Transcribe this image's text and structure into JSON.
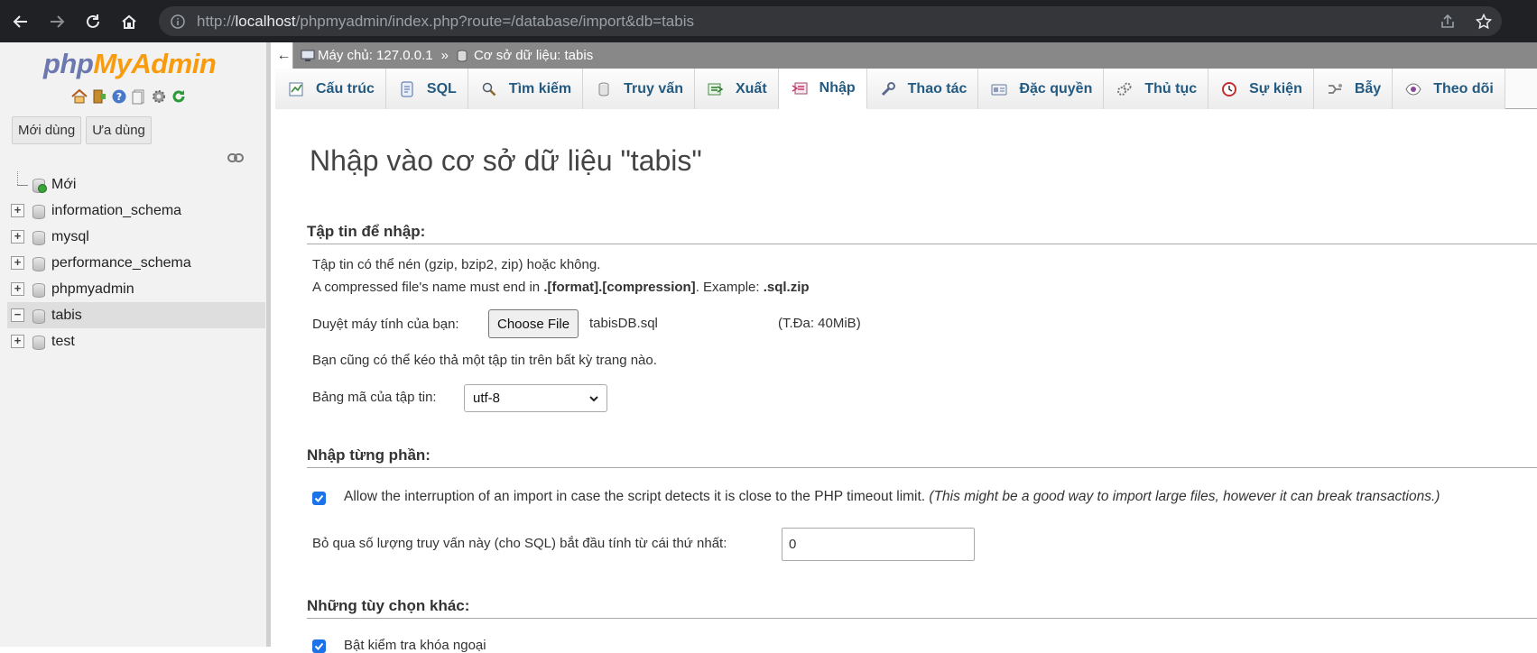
{
  "browser": {
    "url_prefix": "http://",
    "url_host": "localhost",
    "url_path": "/phpmyadmin/index.php?route=/database/import&db=tabis"
  },
  "sidebar": {
    "logo_php": "php",
    "logo_myadmin": "MyAdmin",
    "recent_label": "Mới dùng",
    "favorites_label": "Ưa dùng",
    "tree": [
      {
        "label": "Mới",
        "type": "new"
      },
      {
        "label": "information_schema",
        "type": "db"
      },
      {
        "label": "mysql",
        "type": "db"
      },
      {
        "label": "performance_schema",
        "type": "db"
      },
      {
        "label": "phpmyadmin",
        "type": "db"
      },
      {
        "label": "tabis",
        "type": "db",
        "selected": true
      },
      {
        "label": "test",
        "type": "db"
      }
    ]
  },
  "breadcrumb": {
    "collapse_glyph": "←",
    "server": "Máy chủ: 127.0.0.1",
    "separator": "»",
    "database": "Cơ sở dữ liệu: tabis"
  },
  "tabs": [
    {
      "label": "Cấu trúc",
      "icon": "structure-icon"
    },
    {
      "label": "SQL",
      "icon": "sql-icon"
    },
    {
      "label": "Tìm kiếm",
      "icon": "search-icon"
    },
    {
      "label": "Truy vấn",
      "icon": "query-icon"
    },
    {
      "label": "Xuất",
      "icon": "export-icon"
    },
    {
      "label": "Nhập",
      "icon": "import-icon",
      "active": true
    },
    {
      "label": "Thao tác",
      "icon": "operations-icon"
    },
    {
      "label": "Đặc quyền",
      "icon": "privileges-icon"
    },
    {
      "label": "Thủ tục",
      "icon": "routines-icon"
    },
    {
      "label": "Sự kiện",
      "icon": "events-icon"
    },
    {
      "label": "Bẫy",
      "icon": "triggers-icon"
    },
    {
      "label": "Theo dõi",
      "icon": "tracking-icon"
    }
  ],
  "page": {
    "title": "Nhập vào cơ sở dữ liệu \"tabis\"",
    "file_section": {
      "heading": "Tập tin để nhập:",
      "compress_note": "Tập tin có thể nén (gzip, bzip2, zip) hoặc không.",
      "compressed_prefix": "A compressed file's name must end in ",
      "compressed_format": ".[format].[compression]",
      "compressed_mid": ". Example: ",
      "compressed_example": ".sql.zip",
      "browse_label": "Duyệt máy tính của bạn:",
      "choose_button": "Choose File",
      "file_name": "tabisDB.sql",
      "max_size": "(T.Đa: 40MiB)",
      "drag_note": "Bạn cũng có thể kéo thả một tập tin trên bất kỳ trang nào.",
      "charset_label": "Bảng mã của tập tin:",
      "charset_value": "utf-8"
    },
    "partial_section": {
      "heading": "Nhập từng phần:",
      "interrupt_text": "Allow the interruption of an import in case the script detects it is close to the PHP timeout limit. ",
      "interrupt_note": "(This might be a good way to import large files, however it can break transactions.)",
      "skip_label": "Bỏ qua số lượng truy vấn này (cho SQL) bắt đầu tính từ cái thứ nhất:",
      "skip_value": "0"
    },
    "other_section": {
      "heading": "Những tùy chọn khác:",
      "foreign_key_label": "Bật kiểm tra khóa ngoại"
    }
  }
}
